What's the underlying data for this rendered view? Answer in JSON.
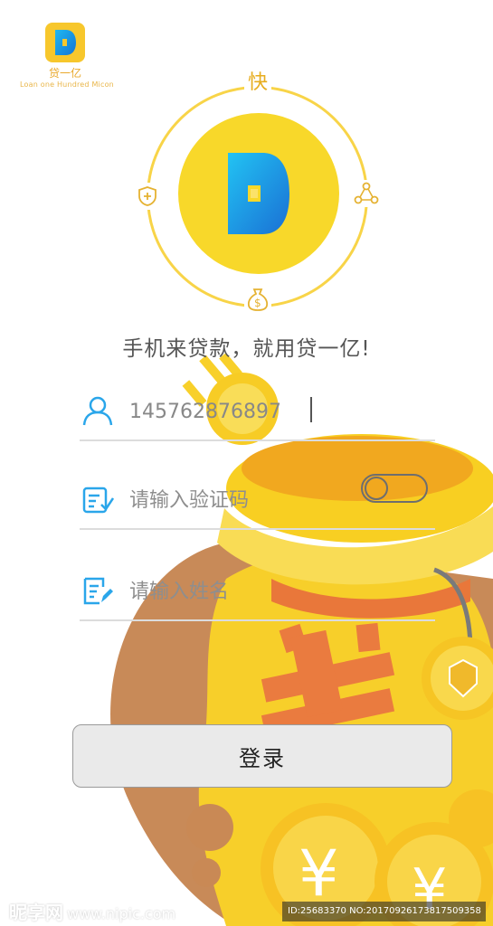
{
  "brand": {
    "name_cn": "贷一亿",
    "name_en": "Loan one Hundred Micon",
    "badge_letter": "D",
    "color": "#f7c72c"
  },
  "orbit": {
    "top_label": "快",
    "icons": [
      "shield-plus-icon",
      "network-nodes-icon",
      "money-bag-icon"
    ],
    "ring_color": "#f8d448"
  },
  "slogan": "手机来贷款，就用贷一亿!",
  "form": {
    "phone": {
      "icon": "user-icon",
      "value": "145762876897"
    },
    "code": {
      "icon": "verify-code-icon",
      "placeholder": "请输入验证码"
    },
    "name": {
      "icon": "edit-document-icon",
      "placeholder": "请输入姓名"
    }
  },
  "login_label": "登录",
  "accent_colors": {
    "icon_blue": "#2aa6ea",
    "gold": "#f8d82a",
    "orange": "#e98a3a"
  },
  "watermark": {
    "left": "昵享网",
    "left_url": "www.nipic.com",
    "right": "ID:25683370 NO:20170926173817509358"
  }
}
